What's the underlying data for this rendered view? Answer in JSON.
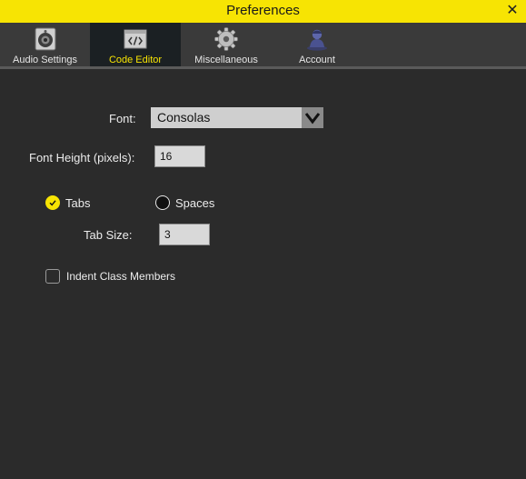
{
  "window": {
    "title": "Preferences",
    "close_icon": "close-icon",
    "accent_color": "#f7e403"
  },
  "tabs": [
    {
      "label": "Audio Settings",
      "icon": "speaker-icon",
      "active": false
    },
    {
      "label": "Code Editor",
      "icon": "code-icon",
      "active": true
    },
    {
      "label": "Miscellaneous",
      "icon": "gear-icon",
      "active": false
    },
    {
      "label": "Account",
      "icon": "user-icon",
      "active": false
    }
  ],
  "code_editor": {
    "font_label": "Font:",
    "font_value": "Consolas",
    "font_height_label": "Font Height (pixels):",
    "font_height_value": "16",
    "indent_mode": {
      "tabs_label": "Tabs",
      "spaces_label": "Spaces",
      "selected": "Tabs"
    },
    "tab_size_label": "Tab Size:",
    "tab_size_value": "3",
    "indent_class_members_label": "Indent Class Members",
    "indent_class_members_checked": false
  }
}
